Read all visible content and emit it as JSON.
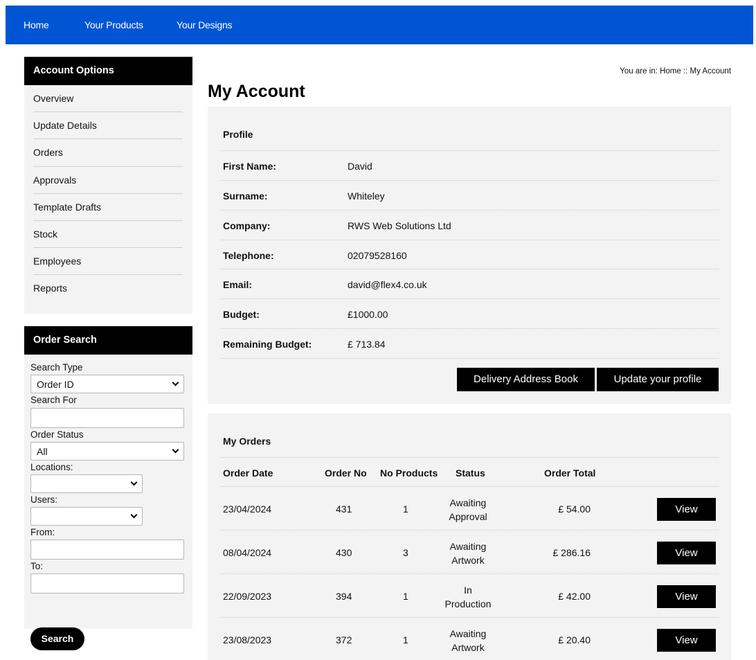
{
  "nav": [
    "Home",
    "Your Products",
    "Your Designs"
  ],
  "account_options": {
    "title": "Account Options",
    "items": [
      "Overview",
      "Update Details",
      "Orders",
      "Approvals",
      "Template Drafts",
      "Stock",
      "Employees",
      "Reports"
    ]
  },
  "order_search": {
    "title": "Order Search",
    "search_type_label": "Search Type",
    "search_type_value": "Order ID",
    "search_for_label": "Search For",
    "search_for_value": "",
    "order_status_label": "Order Status",
    "order_status_value": "All",
    "locations_label": "Locations:",
    "locations_value": "",
    "users_label": "Users:",
    "users_value": "",
    "from_label": "From:",
    "from_value": "",
    "to_label": "To:",
    "to_value": "",
    "search_button": "Search"
  },
  "breadcrumb": {
    "prefix": "You are in:",
    "home": "Home",
    "sep": "::",
    "current": "My Account"
  },
  "page_title": "My Account",
  "profile": {
    "title": "Profile",
    "rows": [
      {
        "label": "First Name:",
        "value": "David"
      },
      {
        "label": "Surname:",
        "value": "Whiteley"
      },
      {
        "label": "Company:",
        "value": "RWS Web Solutions Ltd"
      },
      {
        "label": "Telephone:",
        "value": "02079528160"
      },
      {
        "label": "Email:",
        "value": "david@flex4.co.uk"
      },
      {
        "label": "Budget:",
        "value": "£1000.00"
      },
      {
        "label": "Remaining Budget:",
        "value": "£ 713.84"
      }
    ],
    "delivery_button": "Delivery Address Book",
    "update_button": "Update your profile"
  },
  "orders": {
    "title": "My Orders",
    "headers": [
      "Order Date",
      "Order No",
      "No Products",
      "Status",
      "Order Total"
    ],
    "rows": [
      {
        "date": "23/04/2024",
        "no": "431",
        "products": "1",
        "status1": "Awaiting",
        "status2": "Approval",
        "total": "£ 54.00",
        "action": "View"
      },
      {
        "date": "08/04/2024",
        "no": "430",
        "products": "3",
        "status1": "Awaiting",
        "status2": "Artwork",
        "total": "£ 286.16",
        "action": "View"
      },
      {
        "date": "22/09/2023",
        "no": "394",
        "products": "1",
        "status1": "In",
        "status2": "Production",
        "total": "£ 42.00",
        "action": "View"
      },
      {
        "date": "23/08/2023",
        "no": "372",
        "products": "1",
        "status1": "Awaiting",
        "status2": "Artwork",
        "total": "£ 20.40",
        "action": "View"
      }
    ]
  }
}
